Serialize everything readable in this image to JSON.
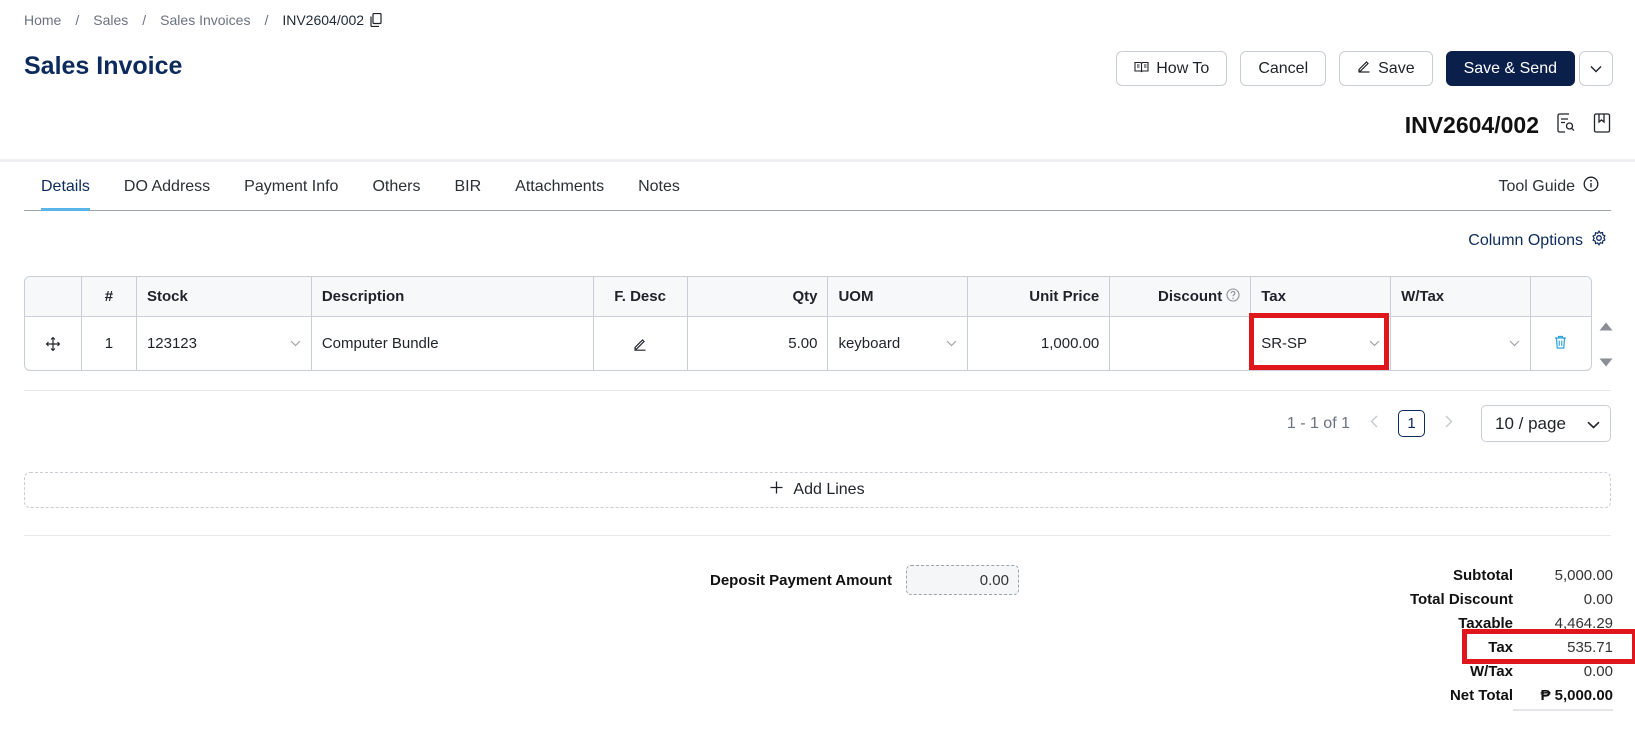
{
  "breadcrumb": {
    "home": "Home",
    "sales": "Sales",
    "invoices": "Sales Invoices",
    "current": "INV2604/002"
  },
  "page_title": "Sales Invoice",
  "actions": {
    "how_to": "How To",
    "cancel": "Cancel",
    "save": "Save",
    "save_send": "Save & Send"
  },
  "doc_number": "INV2604/002",
  "tabs": [
    "Details",
    "DO Address",
    "Payment Info",
    "Others",
    "BIR",
    "Attachments",
    "Notes"
  ],
  "active_tab": "Details",
  "tool_guide": "Tool Guide",
  "column_options": "Column Options",
  "table": {
    "headers": {
      "num": "#",
      "stock": "Stock",
      "description": "Description",
      "fdesc": "F. Desc",
      "qty": "Qty",
      "uom": "UOM",
      "unit_price": "Unit Price",
      "discount": "Discount",
      "tax": "Tax",
      "wtax": "W/Tax"
    },
    "rows": [
      {
        "num": "1",
        "stock": "123123",
        "description": "Computer Bundle",
        "qty": "5.00",
        "uom": "keyboard",
        "unit_price": "1,000.00",
        "discount": "",
        "tax": "SR-SP",
        "wtax": ""
      }
    ]
  },
  "pagination": {
    "range": "1 - 1 of 1",
    "current_page": "1",
    "page_size": "10 / page"
  },
  "add_lines": "Add Lines",
  "deposit": {
    "label": "Deposit Payment Amount",
    "value": "0.00"
  },
  "totals": {
    "subtotal_label": "Subtotal",
    "subtotal": "5,000.00",
    "discount_label": "Total Discount",
    "discount": "0.00",
    "taxable_label": "Taxable",
    "taxable": "4,464.29",
    "tax_label": "Tax",
    "tax": "535.71",
    "wtax_label": "W/Tax",
    "wtax": "0.00",
    "net_label": "Net Total",
    "net": "₱ 5,000.00"
  },
  "colors": {
    "primary": "#0b1f4b",
    "accent": "#5ab6e8",
    "highlight": "#e0161d",
    "delete": "#2aa1e0"
  }
}
